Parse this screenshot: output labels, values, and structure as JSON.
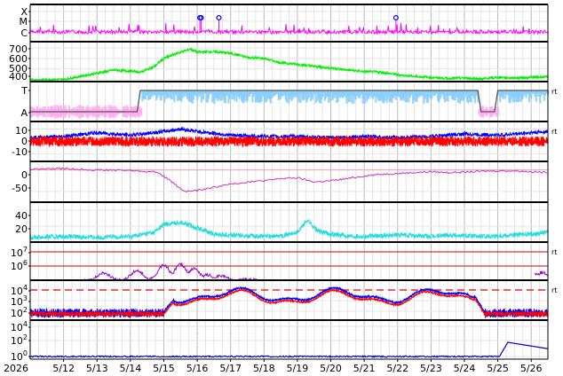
{
  "chart_data": [
    {
      "type": "line",
      "yticks": [
        "X",
        "M",
        "C"
      ],
      "color": "#ff00ff",
      "markers": [
        {
          "date": "5/16.08",
          "label_color": "#0000ff"
        },
        {
          "date": "5/16.12",
          "label_color": "#0000ff"
        },
        {
          "date": "5/16.65",
          "label_color": "#0000ff"
        },
        {
          "date": "5/21.95",
          "label_color": "#0000ff"
        }
      ]
    },
    {
      "type": "line",
      "yticks": [
        "700",
        "600",
        "500",
        "400"
      ],
      "color": "#00ee00",
      "series": [
        {
          "x": [
            "5/11",
            "5/12",
            "5/13",
            "5/13.5",
            "5/14",
            "5/14.3",
            "5/14.7",
            "5/15",
            "5/15.4",
            "5/15.8",
            "5/16",
            "5/16.5",
            "5/17",
            "5/17.5",
            "5/18",
            "5/18.5",
            "5/19",
            "5/19.5",
            "5/20",
            "5/20.5",
            "5/21",
            "5/21.5",
            "5/22",
            "5/22.5",
            "5/23",
            "5/23.5",
            "5/24",
            "5/24.5",
            "5/25",
            "5/25.5",
            "5/26",
            "5/26.5"
          ],
          "values": [
            395,
            400,
            460,
            490,
            480,
            470,
            520,
            600,
            650,
            690,
            660,
            665,
            650,
            610,
            600,
            560,
            545,
            525,
            510,
            490,
            475,
            470,
            445,
            430,
            420,
            410,
            415,
            405,
            420,
            415,
            420,
            425
          ]
        }
      ]
    },
    {
      "type": "area",
      "yticks": [
        "T",
        "A"
      ],
      "right_marker": "rt",
      "colors": {
        "T": "#87cefa",
        "A": "#ffaaee",
        "line": "#555555"
      },
      "state_line": [
        {
          "from": "5/11",
          "to": "5/14.2",
          "state": "A"
        },
        {
          "from": "5/14.3",
          "to": "5/24.4",
          "state": "T"
        },
        {
          "from": "5/24.5",
          "to": "5/24.9",
          "state": "A"
        },
        {
          "from": "5/25",
          "to": "5/26.5",
          "state": "T"
        }
      ]
    },
    {
      "type": "line",
      "yticks": [
        "10",
        "0",
        "-10"
      ],
      "right_marker": "rt",
      "series": [
        {
          "color": "#0000ff"
        },
        {
          "color": "#ff0000"
        }
      ]
    },
    {
      "type": "line",
      "yticks": [
        "0",
        "-50"
      ],
      "color": "#cc33cc",
      "reference_line": {
        "value": 0,
        "color": "#ff9999"
      },
      "series": [
        {
          "x": [
            "5/11",
            "5/12",
            "5/13",
            "5/14",
            "5/14.8",
            "5/15.2",
            "5/15.6",
            "5/16",
            "5/16.5",
            "5/17",
            "5/17.5",
            "5/18",
            "5/18.5",
            "5/19",
            "5/19.5",
            "5/20",
            "5/20.5",
            "5/21",
            "5/21.5",
            "5/22",
            "5/22.5",
            "5/23",
            "5/23.5",
            "5/24",
            "5/24.5",
            "5/25",
            "5/25.5",
            "5/26",
            "5/26.5"
          ],
          "values": [
            2,
            3,
            0,
            -1,
            -5,
            -25,
            -50,
            -48,
            -40,
            -33,
            -28,
            -25,
            -20,
            -18,
            -28,
            -25,
            -20,
            -14,
            -10,
            -8,
            -6,
            -4,
            -6,
            -5,
            -3,
            -2,
            -2,
            -4,
            -6
          ]
        }
      ]
    },
    {
      "type": "line",
      "yticks": [
        "40",
        "20"
      ],
      "color": "#22dddd",
      "series": [
        {
          "x": [
            "5/11",
            "5/12",
            "5/13",
            "5/14",
            "5/14.7",
            "5/15",
            "5/15.5",
            "5/16",
            "5/16.5",
            "5/17",
            "5/17.5",
            "5/18",
            "5/18.5",
            "5/19",
            "5/19.3",
            "5/19.6",
            "5/20",
            "5/20.5",
            "5/21",
            "5/21.5",
            "5/22",
            "5/22.5",
            "5/23",
            "5/23.5",
            "5/24",
            "5/24.5",
            "5/25",
            "5/25.5",
            "5/26",
            "5/26.5"
          ],
          "values": [
            6,
            7,
            6,
            7,
            12,
            22,
            25,
            18,
            10,
            9,
            8,
            7,
            8,
            12,
            28,
            14,
            10,
            8,
            7,
            8,
            9,
            8,
            7,
            9,
            8,
            7,
            8,
            9,
            10,
            12
          ]
        }
      ]
    },
    {
      "type": "line",
      "yticks": [
        "10^7",
        "10^6"
      ],
      "right_marker": "rt",
      "log_scale": true,
      "color": "#9900cc",
      "threshold_color": "#dd0000"
    },
    {
      "type": "line",
      "yticks": [
        "10^4",
        "10^3",
        "10^2"
      ],
      "right_marker": "rt",
      "log_scale": true,
      "series": [
        {
          "color": "#0000ff"
        },
        {
          "color": "#ff0000"
        }
      ],
      "threshold": {
        "value": 10000,
        "color": "#dd0000",
        "style": "dashed"
      }
    },
    {
      "type": "line",
      "yticks": [
        "10^4",
        "10^2",
        "10^0"
      ],
      "log_scale": true,
      "color": "#0000cc",
      "series": [
        {
          "x": [
            "5/11",
            "5/25",
            "5/25.1",
            "5/25.3",
            "5/25.6",
            "5/26",
            "5/26.5"
          ],
          "values": [
            1,
            1,
            30,
            200,
            100,
            60,
            40
          ]
        }
      ]
    }
  ],
  "x_axis": {
    "year_label": "2026",
    "tick_labels": [
      "5/12",
      "5/13",
      "5/14",
      "5/15",
      "5/16",
      "5/17",
      "5/18",
      "5/19",
      "5/20",
      "5/21",
      "5/22",
      "5/23",
      "5/24",
      "5/25",
      "5/26"
    ],
    "range": [
      "5/11",
      "5/26.5"
    ]
  }
}
